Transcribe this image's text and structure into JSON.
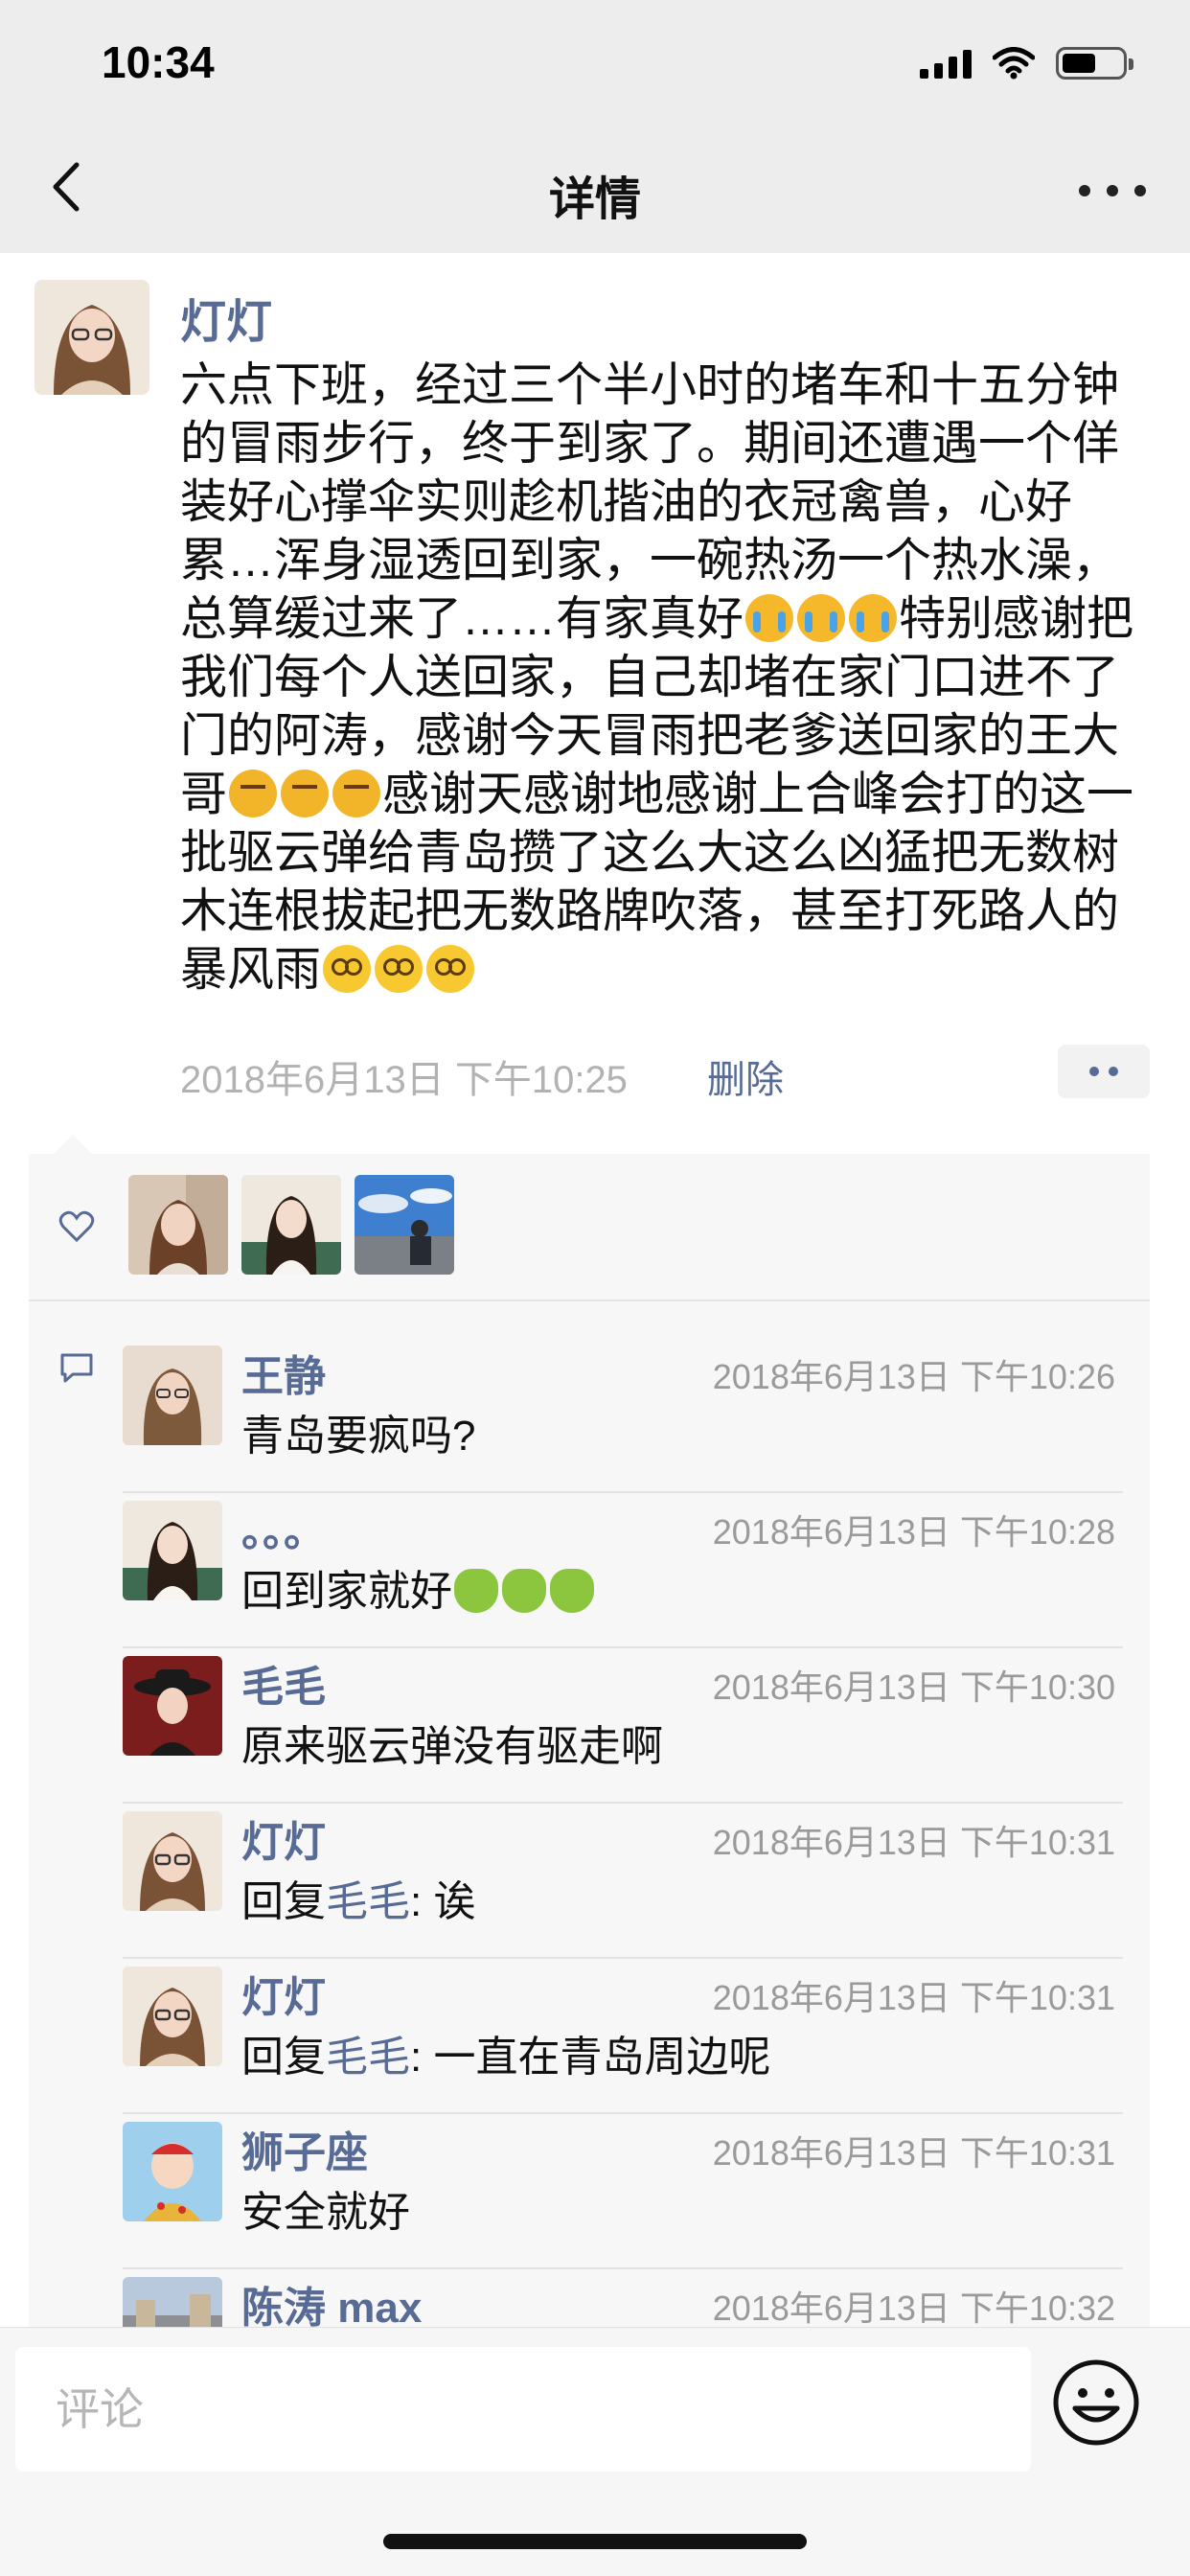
{
  "status_bar": {
    "time": "10:34",
    "battery_level": 0.55
  },
  "nav": {
    "title": "详情",
    "back_icon": "chevron-left-icon",
    "more_icon": "more-dots-icon"
  },
  "post": {
    "author": "灯灯",
    "text_parts": [
      "六点下班，经过三个半小时的堵车和十五分钟的冒雨步行，终于到家了。期间还遭遇一个佯装好心撑伞实则趁机揩油的衣冠禽兽，心好累…浑身湿透回到家，一碗热汤一个热水澡，总算缓过来了……有家真好",
      "特别感谢把我们每个人送回家，自己却堵在家门口进不了门的阿涛，感谢今天冒雨把老爹送回家的王大哥",
      "感谢天感谢地感谢上合峰会打的这一批驱云弹给青岛攒了这么大这么凶猛把无数树木连根拔起把无数路牌吹落，甚至打死路人的暴风雨"
    ],
    "emoji_groups": [
      "cry",
      "angry",
      "dizzy"
    ],
    "timestamp": "2018年6月13日 下午10:25",
    "delete_label": "删除"
  },
  "likes": {
    "icon": "heart-icon",
    "count": 3
  },
  "comments": [
    {
      "name": "王静",
      "time": "2018年6月13日 下午10:26",
      "text": "青岛要疯吗?"
    },
    {
      "name": "。。。",
      "time": "2018年6月13日 下午10:28",
      "text": "回到家就好",
      "emoji": "frog"
    },
    {
      "name": "毛毛",
      "time": "2018年6月13日 下午10:30",
      "text": "原来驱云弹没有驱走啊"
    },
    {
      "name": "灯灯",
      "time": "2018年6月13日 下午10:31",
      "reply_prefix": "回复",
      "reply_to": "毛毛",
      "text": ": 诶"
    },
    {
      "name": "灯灯",
      "time": "2018年6月13日 下午10:31",
      "reply_prefix": "回复",
      "reply_to": "毛毛",
      "text": ": 一直在青岛周边呢"
    },
    {
      "name": "狮子座",
      "time": "2018年6月13日 下午10:31",
      "text": "安全就好"
    },
    {
      "name": "陈涛 max",
      "time": "2018年6月13日 下午10:32",
      "text": ""
    }
  ],
  "input": {
    "placeholder": "评论",
    "emoji_icon": "smiley-face-icon"
  },
  "colors": {
    "link": "#576b95",
    "nav_bg": "#ededed",
    "panel_bg": "#f7f7f7",
    "meta": "#b2b2b2"
  }
}
